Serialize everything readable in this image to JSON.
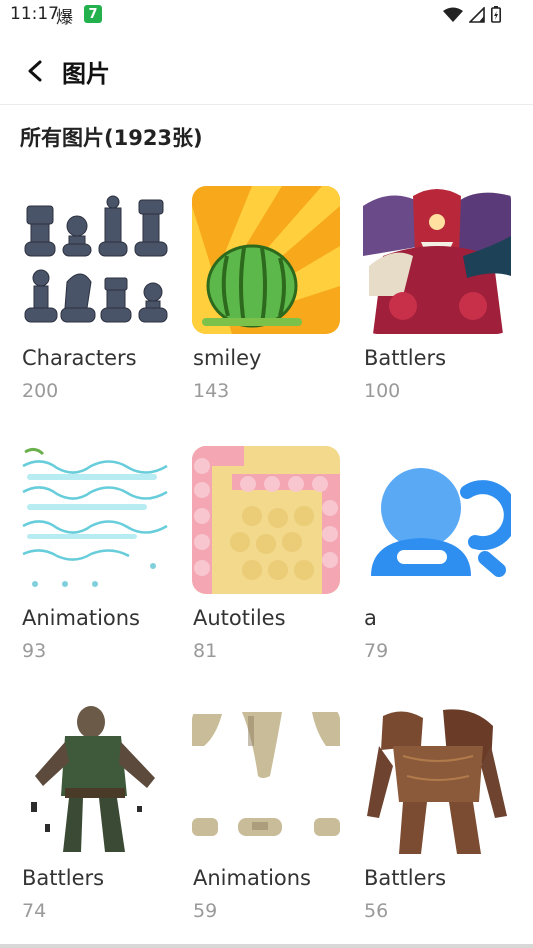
{
  "status_bar": {
    "time": "11:17",
    "extra_char": "爆",
    "badge": "7"
  },
  "header": {
    "title": "图片"
  },
  "section": {
    "title": "所有图片(1923张)"
  },
  "albums": [
    {
      "name": "Characters",
      "count": "200",
      "icon": "chess-pieces-thumb"
    },
    {
      "name": "smiley",
      "count": "143",
      "icon": "watermelon-thumb"
    },
    {
      "name": "Battlers",
      "count": "100",
      "icon": "demon-thumb"
    },
    {
      "name": "Animations",
      "count": "93",
      "icon": "wave-effects-thumb"
    },
    {
      "name": "Autotiles",
      "count": "81",
      "icon": "cake-tile-thumb"
    },
    {
      "name": "a",
      "count": "79",
      "icon": "user-group-thumb"
    },
    {
      "name": "Battlers",
      "count": "74",
      "icon": "zombie-thumb"
    },
    {
      "name": "Animations",
      "count": "59",
      "icon": "bone-effects-thumb"
    },
    {
      "name": "Battlers",
      "count": "56",
      "icon": "ghoul-thumb"
    }
  ],
  "colors": {
    "accent_blue": "#2f8ff0",
    "badge_green": "#22b14c"
  }
}
